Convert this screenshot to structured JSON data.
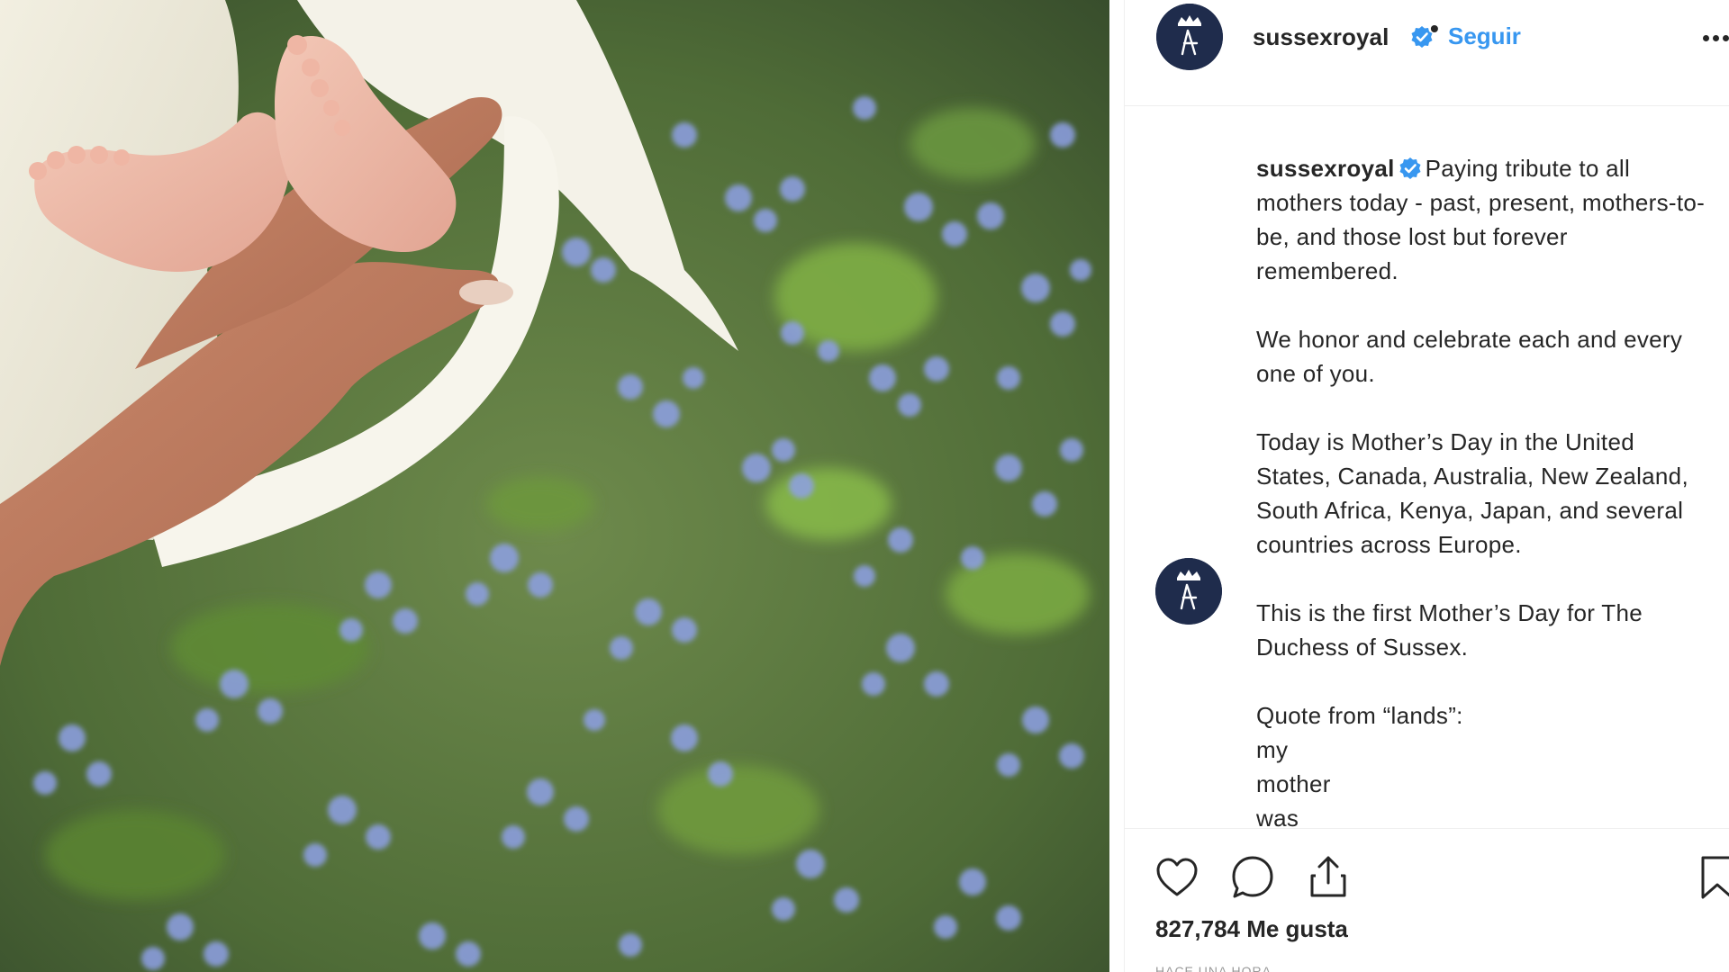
{
  "photo": {
    "description_icon": "photo-image",
    "accent_flower": "#8ea0e6",
    "accent_leaf": "#6f9a3e"
  },
  "header": {
    "username": "sussexroyal",
    "separator": "•",
    "follow_label": "Seguir",
    "verified_icon": "verified-badge-icon",
    "more_icon": "more-options-icon"
  },
  "caption": {
    "username": "sussexroyal",
    "verified_icon": "verified-badge-icon",
    "first_line": "Paying tribute to all mothers today - past, present, mothers-to-be, and those lost but forever remembered.",
    "paragraphs": [
      "We honor and celebrate each and every one of you.",
      "Today is Mother’s Day in the United States, Canada, Australia, New Zealand, South Africa, Kenya, Japan, and several countries across Europe.",
      "This is the first Mother’s Day for The Duchess of Sussex.",
      "Quote from “lands”:",
      "my",
      "mother",
      "was"
    ]
  },
  "actions": {
    "like_icon": "heart-icon",
    "comment_icon": "comment-bubble-icon",
    "share_icon": "share-upload-icon",
    "save_icon": "bookmark-icon",
    "likes_count": "827,784 Me gusta",
    "time_ago": "HACE UNA HORA"
  },
  "colors": {
    "link": "#3897f0",
    "text": "#262626",
    "avatar_bg": "#1f2c4c",
    "border": "#efefef"
  }
}
